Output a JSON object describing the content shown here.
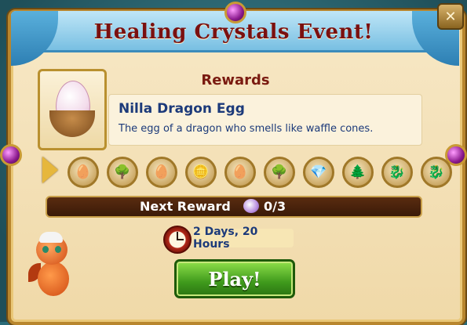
{
  "event": {
    "title": "Healing Crystals Event!",
    "close_icon": "close-icon"
  },
  "rewards": {
    "heading": "Rewards",
    "featured": {
      "icon": "nilla-dragon-egg-icon",
      "name": "Nilla Dragon Egg",
      "description": "The egg of a dragon who smells like waffle cones."
    },
    "items": [
      {
        "icon": "egg-icon",
        "glyph": "🥚"
      },
      {
        "icon": "tree-icon",
        "glyph": "🌳"
      },
      {
        "icon": "egg-icon",
        "glyph": "🥚"
      },
      {
        "icon": "gold-coins-icon",
        "glyph": "🪙"
      },
      {
        "icon": "egg-icon",
        "glyph": "🥚"
      },
      {
        "icon": "tree-icon",
        "glyph": "🌳"
      },
      {
        "icon": "crystal-pile-icon",
        "glyph": "💎"
      },
      {
        "icon": "purple-tree-icon",
        "glyph": "🌲"
      },
      {
        "icon": "dragon-icon",
        "glyph": "🐉"
      },
      {
        "icon": "dragon-icon",
        "glyph": "🐉"
      }
    ]
  },
  "next_reward": {
    "label": "Next Reward",
    "icon": "healing-crystal-icon",
    "count": "0/3",
    "progress": 0
  },
  "timer": {
    "icon": "alarm-clock-icon",
    "text": "2 Days, 20 Hours"
  },
  "play": {
    "label": "Play!"
  },
  "colors": {
    "title": "#7a1010",
    "play_button": "#3f9a1c",
    "text_blue": "#1c3a7a"
  }
}
